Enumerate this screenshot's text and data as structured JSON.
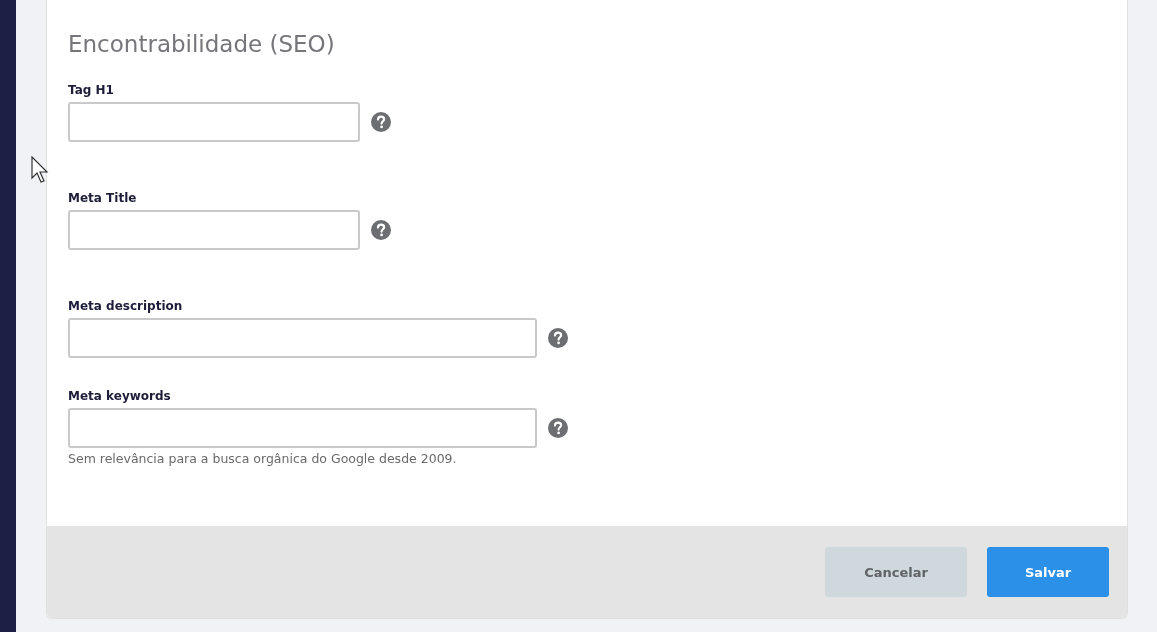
{
  "section": {
    "title": "Encontrabilidade (SEO)"
  },
  "fields": [
    {
      "label": "Tag H1"
    },
    {
      "label": "Meta Title"
    },
    {
      "label": "Meta description"
    },
    {
      "label": "Meta keywords",
      "hint": "Sem relevância para a busca orgânica do Google desde 2009."
    }
  ],
  "buttons": [
    {
      "label": "Cancelar",
      "kind": "secondary"
    },
    {
      "label": "Salvar",
      "kind": "primary"
    }
  ]
}
